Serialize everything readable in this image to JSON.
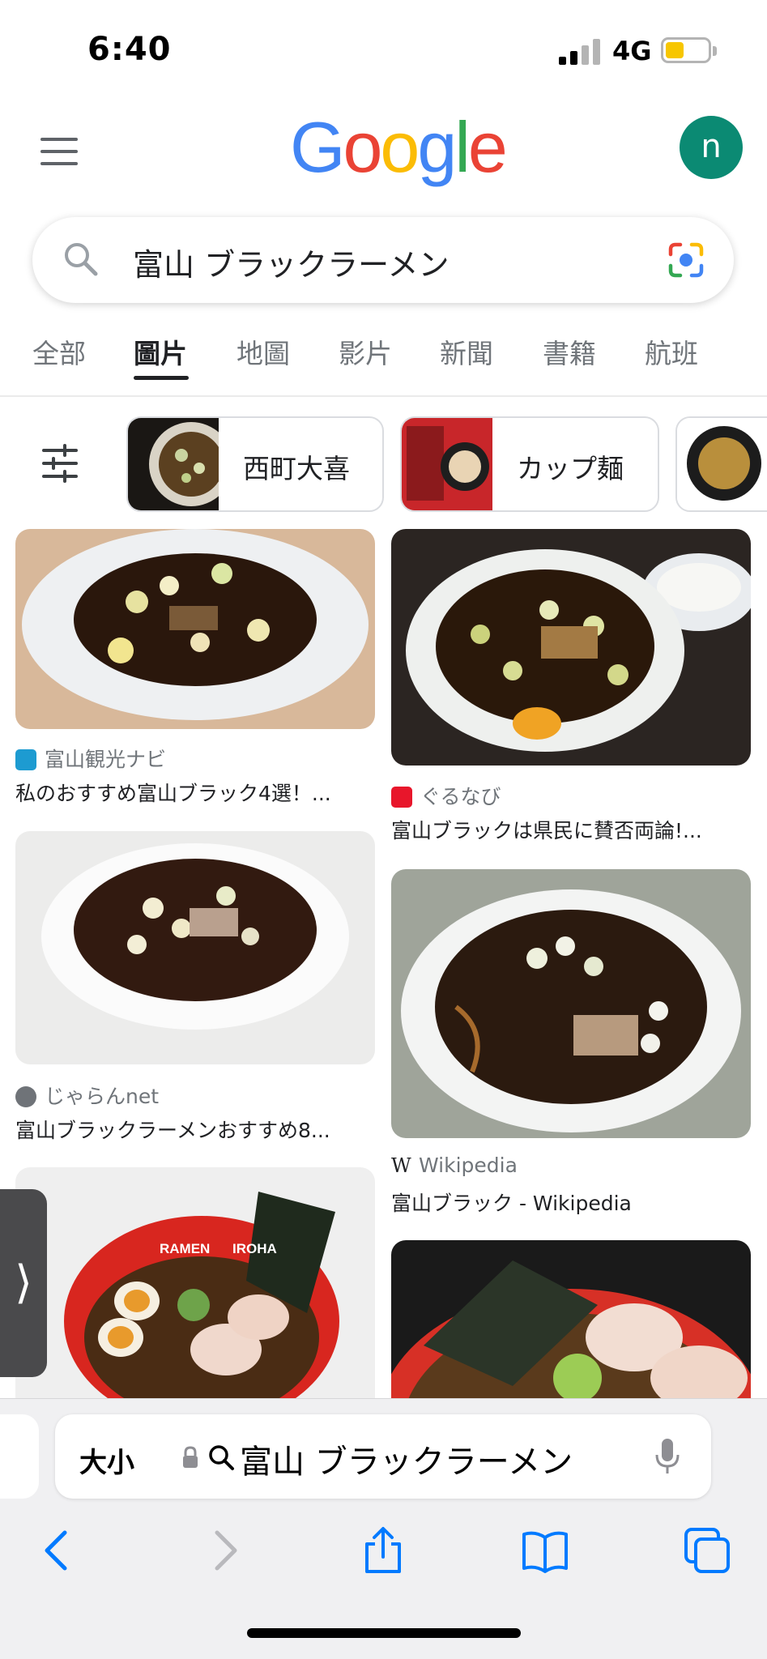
{
  "status_bar": {
    "time": "6:40",
    "network": "4G"
  },
  "header": {
    "logo": "Google",
    "avatar_letter": "n"
  },
  "search": {
    "query": "富山 ブラックラーメン"
  },
  "tabs": [
    {
      "label": "全部",
      "active": false
    },
    {
      "label": "圖片",
      "active": true
    },
    {
      "label": "地圖",
      "active": false
    },
    {
      "label": "影片",
      "active": false
    },
    {
      "label": "新聞",
      "active": false
    },
    {
      "label": "書籍",
      "active": false
    },
    {
      "label": "航班",
      "active": false
    }
  ],
  "chips": [
    {
      "label": "西町大喜"
    },
    {
      "label": "カップ麺"
    }
  ],
  "results": [
    {
      "source": "富山観光ナビ",
      "title": "私のおすすめ富山ブラック4選！..."
    },
    {
      "source": "ぐるなび",
      "title": "富山ブラックは県民に賛否両論!..."
    },
    {
      "source": "じゃらんnet",
      "title": "富山ブラックラーメンおすすめ8..."
    },
    {
      "source": "Wikipedia",
      "title": "富山ブラック - Wikipedia"
    }
  ],
  "image_overlay_text": {
    "bowl_brand_left": "RAMEN",
    "bowl_brand_right": "IROHA"
  },
  "safari": {
    "text_size_label": "大小",
    "url_text": "富山 ブラックラーメン"
  },
  "icons": {
    "menu": "hamburger-menu-icon",
    "search": "search-icon",
    "lens": "camera-lens-icon",
    "tune": "tune-filter-icon",
    "back": "chevron-left-icon",
    "forward": "chevron-right-icon",
    "share": "share-icon",
    "bookmarks": "book-icon",
    "tabs": "tabs-icon",
    "mic": "microphone-icon",
    "lock": "lock-icon"
  },
  "colors": {
    "google_blue": "#4285f4",
    "google_red": "#ea4335",
    "google_yellow": "#fbbc05",
    "google_green": "#34a853",
    "avatar": "#0b8a73",
    "ios_blue": "#007aff",
    "battery": "#f7c600"
  }
}
